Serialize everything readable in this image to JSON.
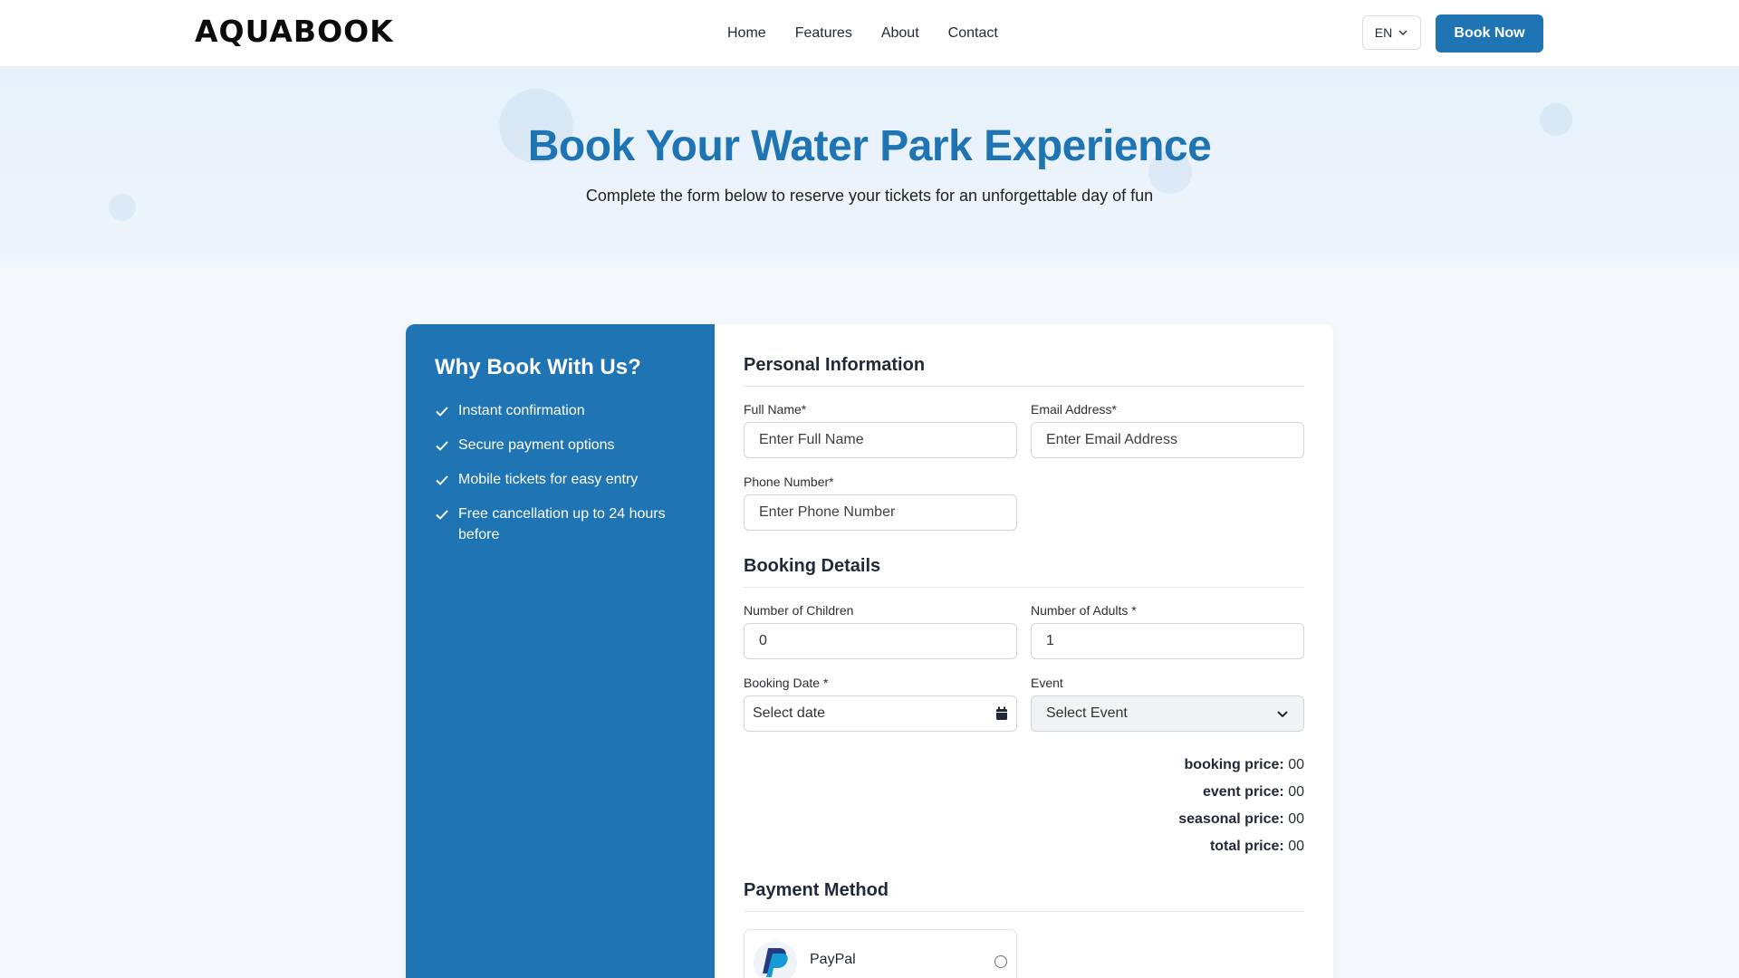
{
  "brand": {
    "logo_text": "AQUABOOK"
  },
  "nav": {
    "items": [
      "Home",
      "Features",
      "About",
      "Contact"
    ]
  },
  "header": {
    "lang": "EN",
    "book_now": "Book Now"
  },
  "hero": {
    "title": "Book Your Water Park Experience",
    "subtitle": "Complete the form below to reserve your tickets for an unforgettable day of fun"
  },
  "side": {
    "title": "Why Book With Us?",
    "benefits": [
      "Instant confirmation",
      "Secure payment options",
      "Mobile tickets for easy entry",
      "Free cancellation up to 24 hours before"
    ]
  },
  "personal": {
    "title": "Personal Information",
    "full_name_label": "Full Name*",
    "full_name_placeholder": "Enter Full Name",
    "email_label": "Email Address*",
    "email_placeholder": "Enter Email Address",
    "phone_label": "Phone Number*",
    "phone_placeholder": "Enter Phone Number"
  },
  "booking": {
    "title": "Booking Details",
    "children_label": "Number of Children",
    "children_value": "0",
    "adults_label": "Number of Adults *",
    "adults_value": "1",
    "date_label": "Booking Date *",
    "date_placeholder": "Select date",
    "event_label": "Event",
    "event_value": "Select Event"
  },
  "prices": [
    {
      "label": "booking price:",
      "value": "00"
    },
    {
      "label": "event price:",
      "value": "00"
    },
    {
      "label": "seasonal price:",
      "value": "00"
    },
    {
      "label": "total price:",
      "value": "00"
    }
  ],
  "payment": {
    "title": "Payment Method",
    "methods": [
      {
        "name": "PayPal",
        "selected": false
      }
    ]
  },
  "colors": {
    "brand": "#1f74b3",
    "hero_bg": "#e6f1fb"
  },
  "icons": [
    "check-icon",
    "chevron-down-icon",
    "calendar-icon",
    "paypal-logo"
  ]
}
